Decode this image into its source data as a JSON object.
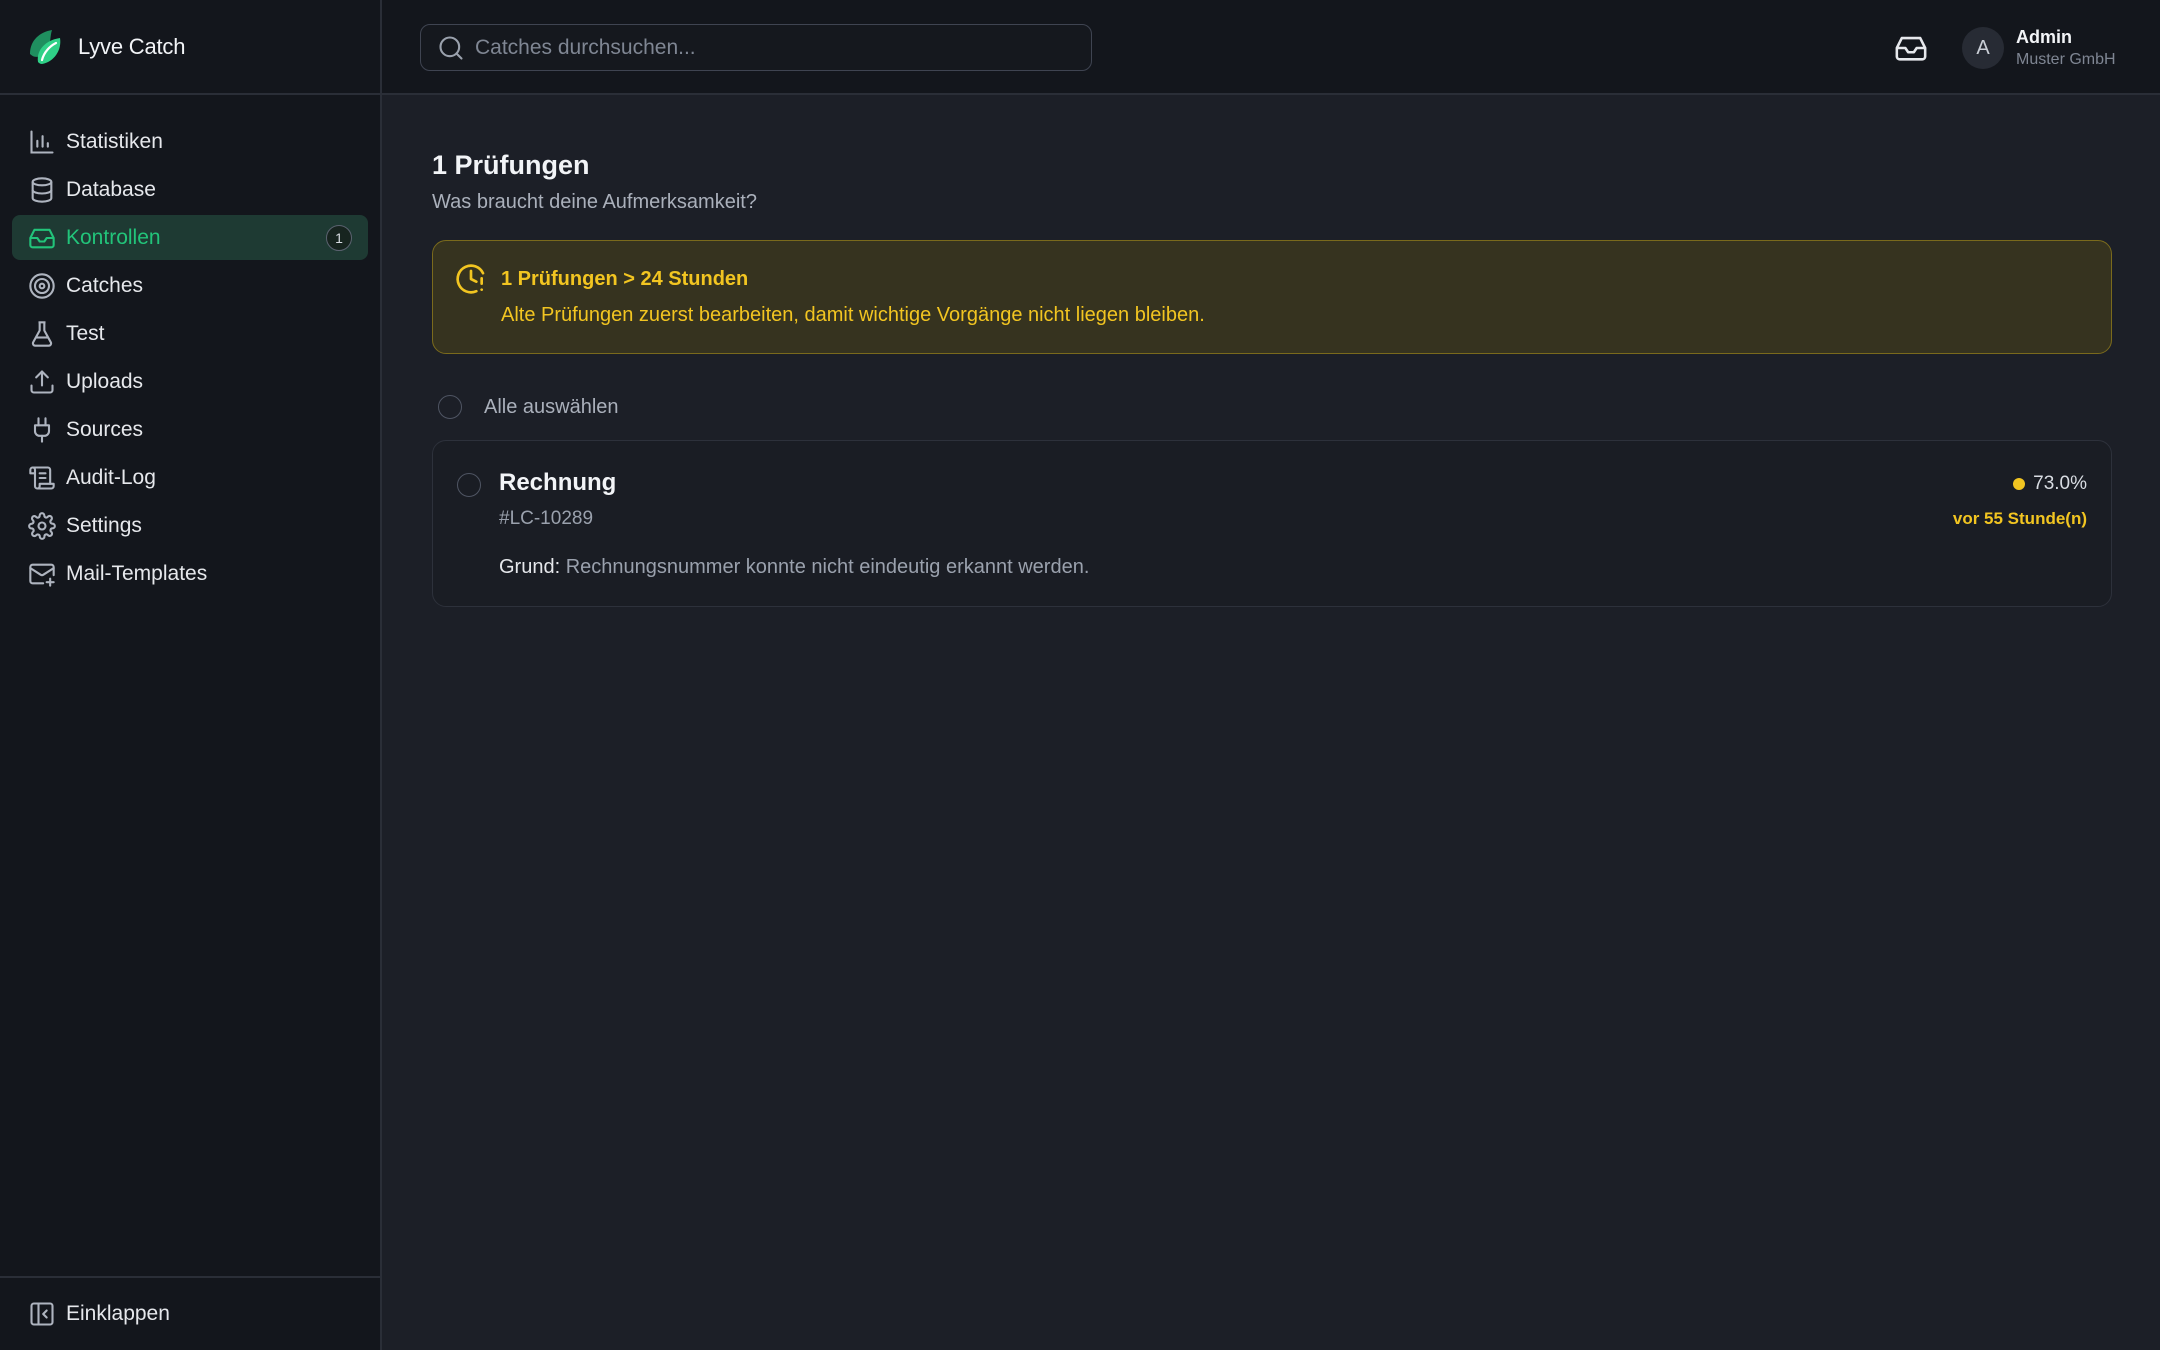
{
  "app": {
    "name": "Lyve Catch"
  },
  "sidebar": {
    "items": [
      {
        "label": "Statistiken",
        "icon": "bar-chart-icon"
      },
      {
        "label": "Database",
        "icon": "database-icon"
      },
      {
        "label": "Kontrollen",
        "icon": "inbox-icon",
        "active": true,
        "badge": "1"
      },
      {
        "label": "Catches",
        "icon": "target-icon"
      },
      {
        "label": "Test",
        "icon": "flask-icon"
      },
      {
        "label": "Uploads",
        "icon": "upload-icon"
      },
      {
        "label": "Sources",
        "icon": "plug-icon"
      },
      {
        "label": "Audit-Log",
        "icon": "scroll-icon"
      },
      {
        "label": "Settings",
        "icon": "gear-icon"
      },
      {
        "label": "Mail-Templates",
        "icon": "mail-plus-icon"
      }
    ],
    "collapse_label": "Einklappen"
  },
  "header": {
    "search_placeholder": "Catches durchsuchen...",
    "user_initial": "A",
    "user_name": "Admin",
    "user_org": "Muster GmbH"
  },
  "main": {
    "title": "1 Prüfungen",
    "subtitle": "Was braucht deine Aufmerksamkeit?",
    "alert": {
      "title": "1 Prüfungen > 24 Stunden",
      "text": "Alte Prüfungen zuerst bearbeiten, damit wichtige Vorgänge nicht liegen bleiben."
    },
    "select_all_label": "Alle auswählen",
    "items": [
      {
        "title": "Rechnung",
        "id": "#LC-10289",
        "reason_label": "Grund:",
        "reason": "Rechnungsnummer konnte nicht eindeutig erkannt werden.",
        "confidence": "73.0%",
        "age": "vor 55 Stunde(n)"
      }
    ]
  },
  "colors": {
    "accent": "#22c47a",
    "warning": "#f2c521",
    "background": "#1c1f27",
    "sidebar": "#13161c"
  }
}
